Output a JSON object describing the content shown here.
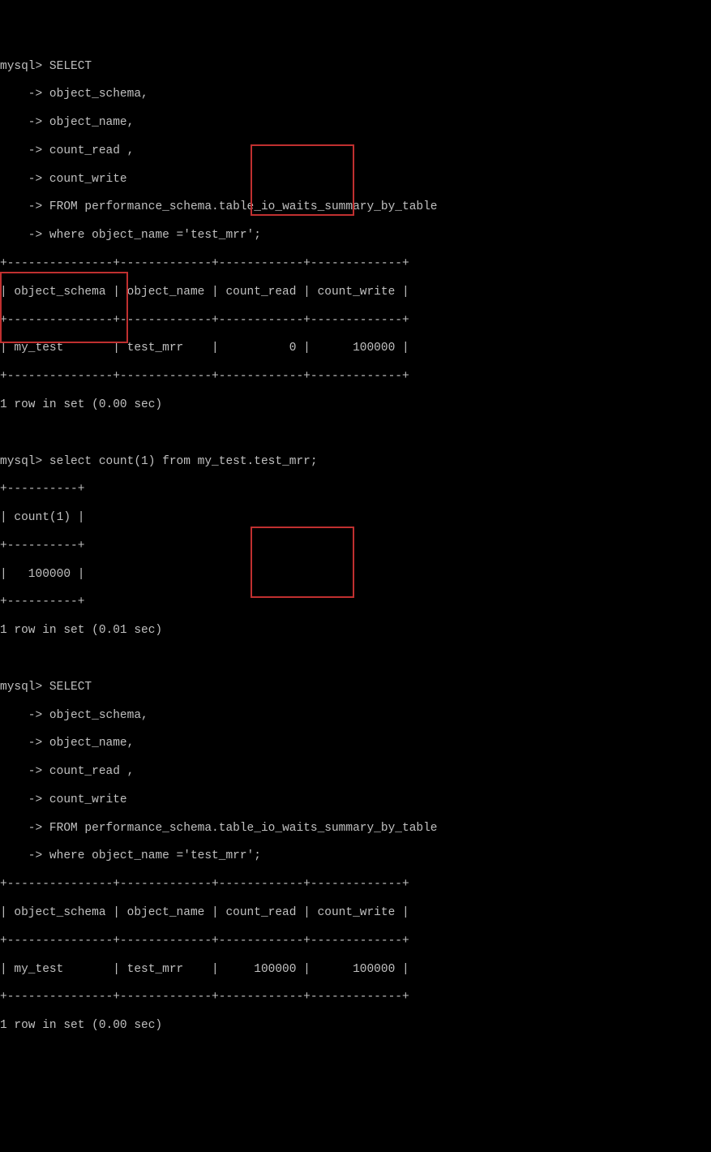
{
  "prompt_main": "mysql>",
  "prompt_cont": "    ->",
  "query1": {
    "l0": " SELECT",
    "l1": " object_schema,",
    "l2": " object_name,",
    "l3": " count_read ,",
    "l4": " count_write",
    "l5": " FROM performance_schema.table_io_waits_summary_by_table",
    "l6": " where object_name ='test_mrr';"
  },
  "table1": {
    "border": "+---------------+-------------+------------+-------------+",
    "header": "| object_schema | object_name | count_read | count_write |",
    "row": "| my_test       | test_mrr    |          0 |      100000 |"
  },
  "result1_footer": "1 row in set (0.00 sec)",
  "query2": " select count(1) from my_test.test_mrr;",
  "table2": {
    "border": "+----------+",
    "header": "| count(1) |",
    "row": "|   100000 |"
  },
  "result2_footer": "1 row in set (0.01 sec)",
  "query3": {
    "l0": " SELECT",
    "l1": " object_schema,",
    "l2": " object_name,",
    "l3": " count_read ,",
    "l4": " count_write",
    "l5": " FROM performance_schema.table_io_waits_summary_by_table",
    "l6": " where object_name ='test_mrr';"
  },
  "table3": {
    "border": "+---------------+-------------+------------+-------------+",
    "header": "| object_schema | object_name | count_read | count_write |",
    "row": "| my_test       | test_mrr    |     100000 |      100000 |"
  },
  "result3_footer": "1 row in set (0.00 sec)",
  "chart_data": {
    "type": "table",
    "tables": [
      {
        "title": "performance_schema.table_io_waits_summary_by_table (before)",
        "columns": [
          "object_schema",
          "object_name",
          "count_read",
          "count_write"
        ],
        "rows": [
          [
            "my_test",
            "test_mrr",
            0,
            100000
          ]
        ]
      },
      {
        "title": "select count(1) from my_test.test_mrr",
        "columns": [
          "count(1)"
        ],
        "rows": [
          [
            100000
          ]
        ]
      },
      {
        "title": "performance_schema.table_io_waits_summary_by_table (after)",
        "columns": [
          "object_schema",
          "object_name",
          "count_read",
          "count_write"
        ],
        "rows": [
          [
            "my_test",
            "test_mrr",
            100000,
            100000
          ]
        ]
      }
    ]
  }
}
